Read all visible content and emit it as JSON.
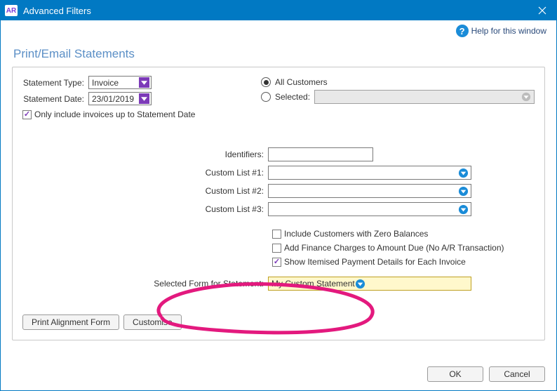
{
  "window": {
    "app_badge": "AR",
    "title": "Advanced Filters",
    "help_text": "Help for this window"
  },
  "heading": "Print/Email Statements",
  "top": {
    "statement_type_label": "Statement Type:",
    "statement_type_value": "Invoice",
    "statement_date_label": "Statement Date:",
    "statement_date_value": "23/01/2019",
    "only_include_label": "Only include invoices up to Statement Date",
    "all_customers_label": "All Customers",
    "selected_label": "Selected:"
  },
  "mid": {
    "identifiers_label": "Identifiers:",
    "custom1_label": "Custom List #1:",
    "custom2_label": "Custom List #2:",
    "custom3_label": "Custom List #3:"
  },
  "opts": {
    "zero_bal": "Include Customers with Zero Balances",
    "finance_charges": "Add Finance Charges to Amount Due (No A/R Transaction)",
    "itemised": "Show Itemised Payment Details for Each Invoice"
  },
  "form": {
    "label": "Selected Form for Statement:",
    "value": "My Custom Statement"
  },
  "buttons": {
    "print_alignment": "Print Alignment Form",
    "customise": "Customise",
    "ok": "OK",
    "cancel": "Cancel"
  }
}
